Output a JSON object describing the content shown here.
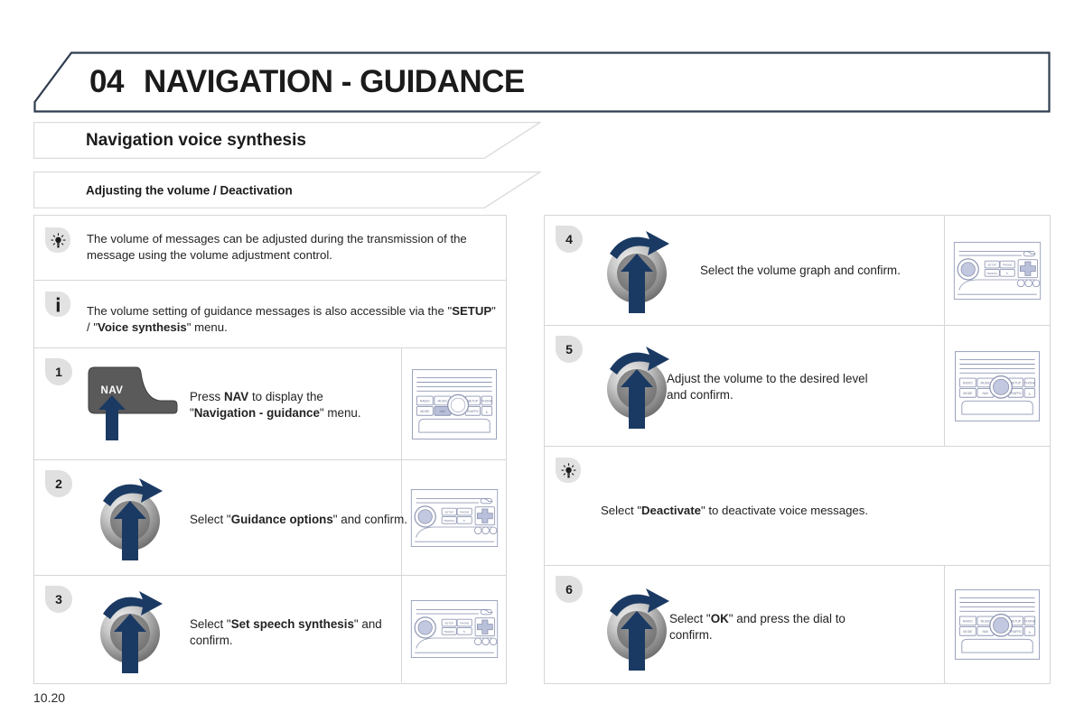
{
  "chapter": {
    "number": "04",
    "title": "NAVIGATION - GUIDANCE"
  },
  "section": {
    "title": "Navigation voice synthesis",
    "subtitle": "Adjusting the volume / Deactivation"
  },
  "page_number": "10.20",
  "colors": {
    "header_border": "#2f3d4f",
    "tab_border": "#d6d6d6",
    "badge_bg": "#e0e0e0",
    "arrow_navy": "#1b3a63",
    "nav_button": "#4d4d4d",
    "panel_blue": "#9aa3c4",
    "panel_outline": "#8a90ad"
  },
  "left_column": {
    "notes": [
      {
        "icon": "lightbulb-tip-icon",
        "segments": [
          {
            "text": "The volume of messages can be adjusted during the transmission of the message using the volume adjustment control.",
            "bold": false
          }
        ]
      },
      {
        "icon": "information-icon",
        "segments": [
          {
            "text": "The volume setting of guidance messages is also accessible via the \"",
            "bold": false
          },
          {
            "text": "SETUP",
            "bold": true
          },
          {
            "text": "\" / \"",
            "bold": false
          },
          {
            "text": "Voice synthesis",
            "bold": true
          },
          {
            "text": "\" menu.",
            "bold": false
          }
        ]
      }
    ],
    "steps": [
      {
        "badge": "1",
        "icon": "nav-button-icon",
        "thumbnail": "radio-panel-center-knob-nav-highlighted",
        "segments": [
          {
            "text": "Press ",
            "bold": false
          },
          {
            "text": "NAV",
            "bold": true
          },
          {
            "text": " to display the\n\"",
            "bold": false
          },
          {
            "text": "Navigation - guidance",
            "bold": true
          },
          {
            "text": "\" menu.",
            "bold": false
          }
        ]
      },
      {
        "badge": "2",
        "icon": "rotary-dial-icon",
        "thumbnail": "radio-panel-left-knob-dpad",
        "segments": [
          {
            "text": "Select \"",
            "bold": false
          },
          {
            "text": "Guidance options",
            "bold": true
          },
          {
            "text": "\" and confirm.",
            "bold": false
          }
        ]
      },
      {
        "badge": "3",
        "icon": "rotary-dial-icon",
        "thumbnail": "radio-panel-left-knob-dpad",
        "segments": [
          {
            "text": "Select \"",
            "bold": false
          },
          {
            "text": "Set speech synthesis",
            "bold": true
          },
          {
            "text": "\" and\nconfirm.",
            "bold": false
          }
        ]
      }
    ]
  },
  "right_column": {
    "steps": [
      {
        "badge": "4",
        "icon": "rotary-dial-icon",
        "thumbnail": "radio-panel-left-knob-dpad",
        "segments": [
          {
            "text": "Select the volume graph and confirm.",
            "bold": false
          }
        ]
      },
      {
        "badge": "5",
        "icon": "rotary-dial-icon",
        "thumbnail": "radio-panel-center-knob",
        "segments": [
          {
            "text": "Adjust the volume to the desired level\nand confirm.",
            "bold": false
          }
        ]
      }
    ],
    "note": {
      "icon": "lightbulb-tip-icon",
      "segments": [
        {
          "text": "Select \"",
          "bold": false
        },
        {
          "text": "Deactivate",
          "bold": true
        },
        {
          "text": "\" to deactivate voice messages.",
          "bold": false
        }
      ]
    },
    "final_step": {
      "badge": "6",
      "icon": "rotary-dial-icon",
      "thumbnail": "radio-panel-center-knob",
      "segments": [
        {
          "text": "Select \"",
          "bold": false
        },
        {
          "text": "OK",
          "bold": true
        },
        {
          "text": "\" and press the dial to\nconfirm.",
          "bold": false
        }
      ]
    }
  },
  "radio_panel_labels": {
    "center_knob_variant": [
      "RADIO",
      "MUSIC",
      "SETUP",
      "PHONE",
      "MODE",
      "NAV",
      "TRAFFIC"
    ],
    "left_knob_variant": [
      "SETUP",
      "PHONE",
      "TRAFFIC"
    ]
  }
}
